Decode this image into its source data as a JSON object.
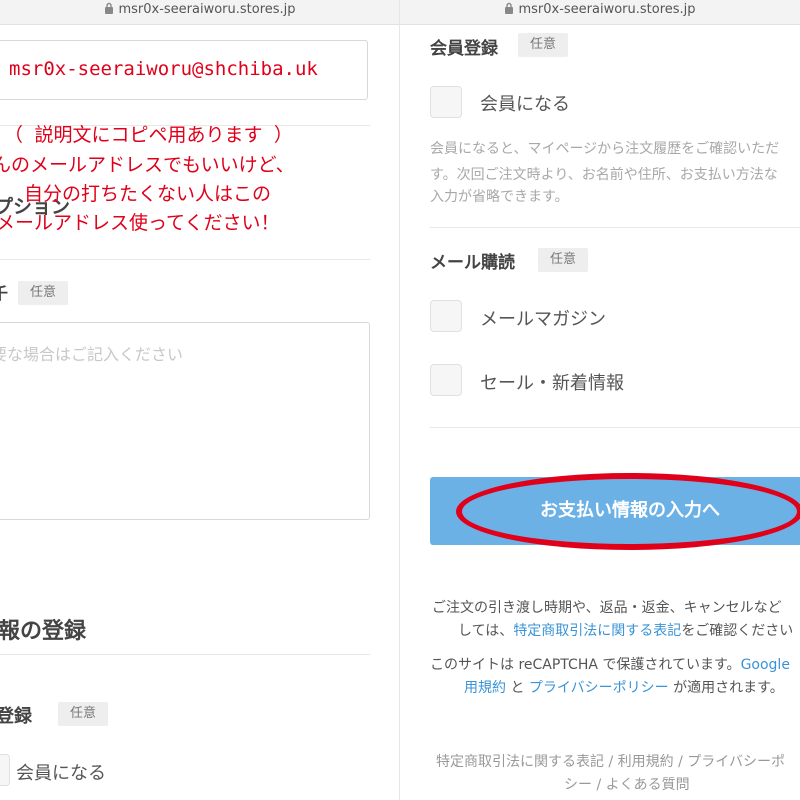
{
  "browser": {
    "url": "msr0x-seeraiworu.stores.jp"
  },
  "left": {
    "email_value": "msr0x-seeraiworu@shchiba.uk",
    "annotation_lines": [
      "（ 説明文にコピペ用あります ）",
      "んのメールアドレスでもいいけど、",
      "自分の打ちたくない人はこの",
      "メールアドレス使ってください！"
    ],
    "option_heading": "プション",
    "note_label": "千",
    "optional_badge": "任意",
    "notes_placeholder": "要な場合はご記入ください",
    "section_heading": "報の登録",
    "member_heading": "登録",
    "member_checkbox_label": "会員になる"
  },
  "right": {
    "member_heading": "会員登録",
    "optional_badge": "任意",
    "member_checkbox_label": "会員になる",
    "member_desc": [
      "会員になると、マイページから注文履歴をご確認いただ",
      "す。次回ご注文時より、お名前や住所、お支払い方法な",
      "入力が省略できます。"
    ],
    "newsletter_heading": "メール購読",
    "newsletter_badge": "任意",
    "newsletter_options": [
      "メールマガジン",
      "セール・新着情報"
    ],
    "payment_button": "お支払い情報の入力へ",
    "notice_line1": "ご注文の引き渡し時期や、返品・返金、キャンセルなど",
    "notice_line2_pre": "しては、",
    "notice_link": "特定商取引法に関する表記",
    "notice_line2_post": "をご確認ください",
    "recaptcha_line1_pre": "このサイトは reCAPTCHA で保護されています。",
    "recaptcha_link_google": "Google",
    "recaptcha_link_terms": "用規約",
    "recaptcha_and": " と ",
    "recaptcha_link_privacy": "プライバシーポリシー",
    "recaptcha_line2_post": " が適用されます。",
    "footer_line1": "特定商取引法に関する表記 / 利用規約 / プライバシーポ",
    "footer_line2": "シー / よくある質問"
  },
  "colors": {
    "accent_button": "#6cb1e6",
    "link": "#3a93d6",
    "annotation_red": "#e0001a"
  }
}
